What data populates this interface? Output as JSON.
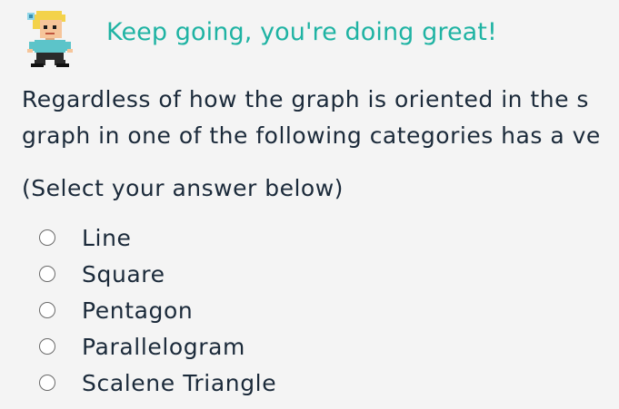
{
  "header": {
    "avatar_icon": "pixel-character-icon",
    "message": "Keep going, you're doing great!",
    "message_color": "#1fb3a3"
  },
  "question": {
    "line1": "Regardless of how the graph is oriented in the s",
    "line2": "graph in one of the following categories has a ve"
  },
  "instruction": "(Select your answer below)",
  "options": [
    {
      "label": "Line"
    },
    {
      "label": "Square"
    },
    {
      "label": "Pentagon"
    },
    {
      "label": "Parallelogram"
    },
    {
      "label": "Scalene Triangle"
    }
  ]
}
